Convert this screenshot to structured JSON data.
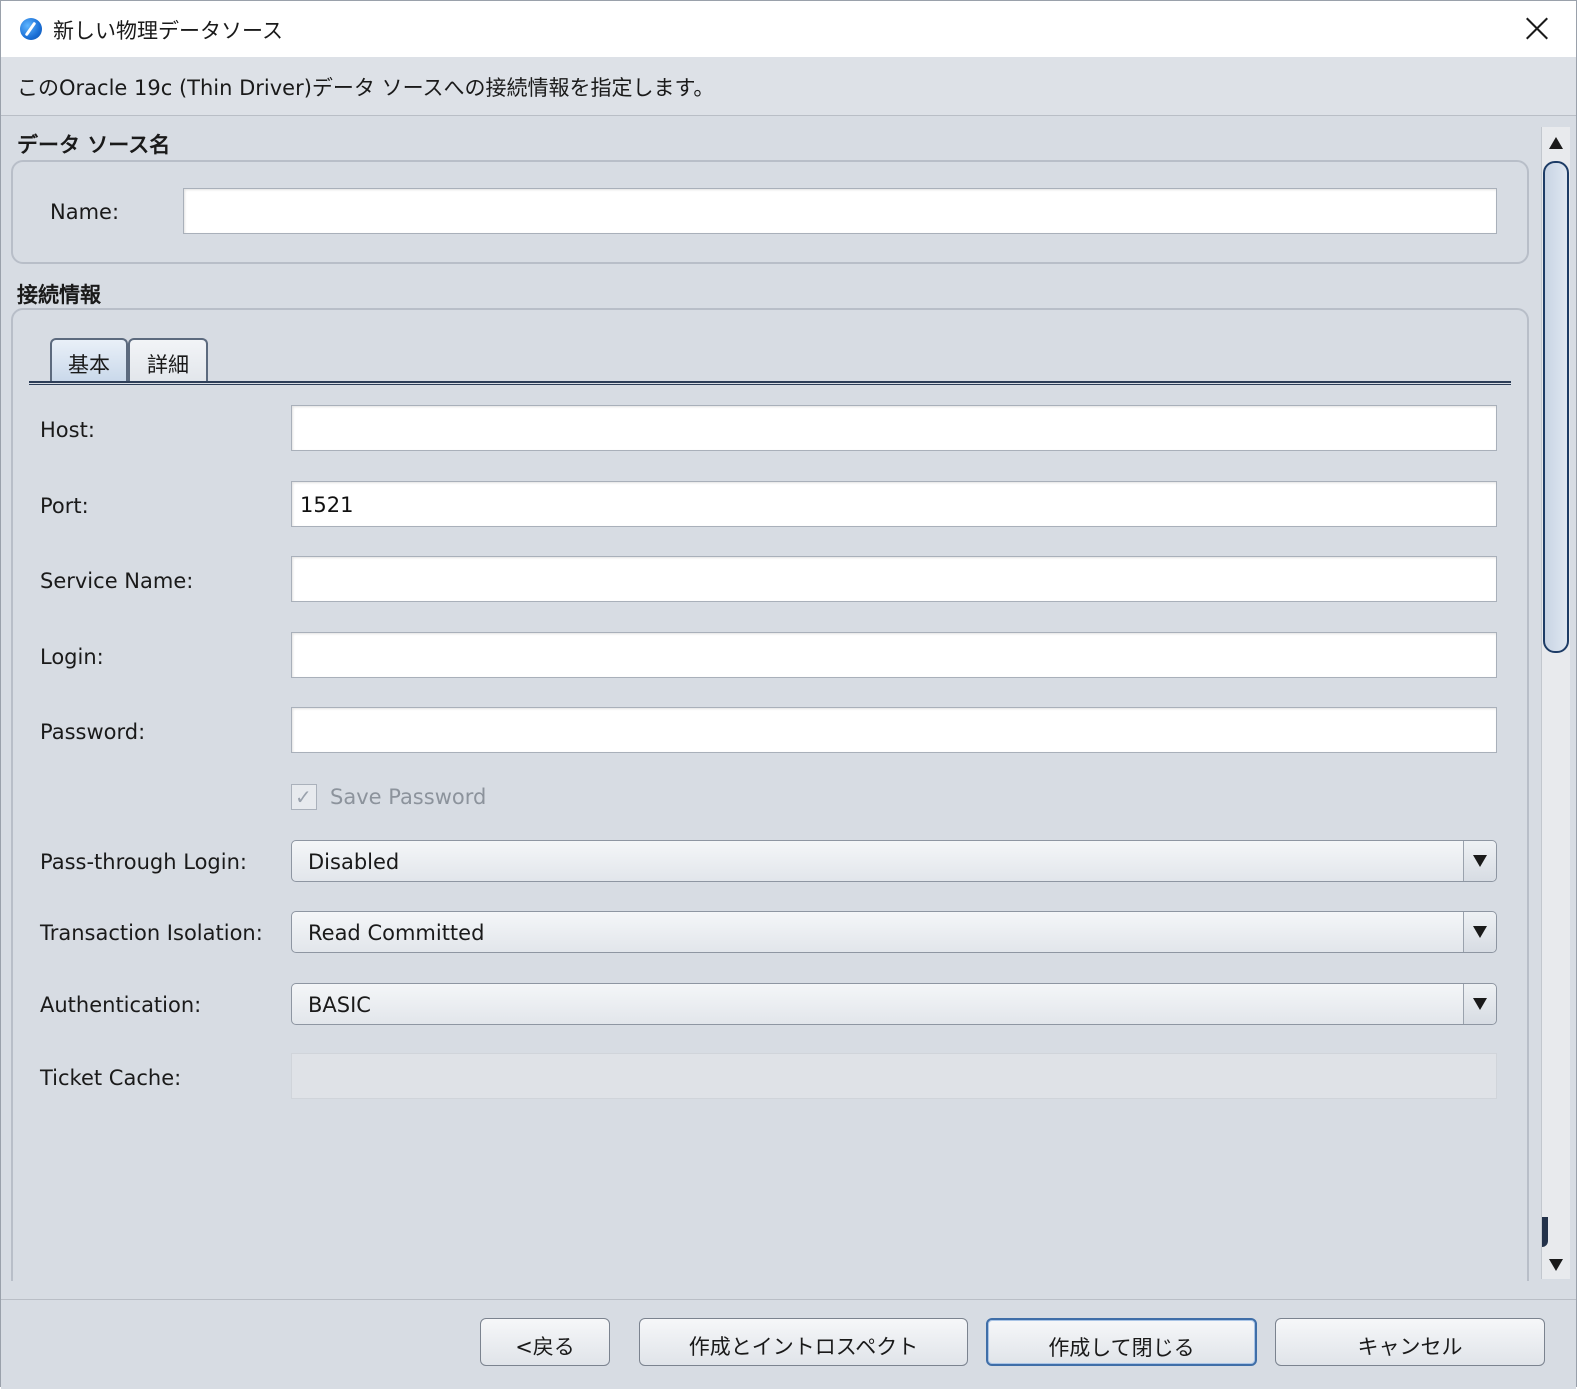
{
  "window": {
    "title": "新しい物理データソース"
  },
  "info": {
    "text": "このOracle 19c (Thin Driver)データ ソースへの接続情報を指定します。"
  },
  "datasource_section": {
    "title": "データ ソース名",
    "name_label": "Name:",
    "name_value": ""
  },
  "connection_section": {
    "title": "接続情報",
    "tabs": [
      {
        "label": "基本",
        "active": true
      },
      {
        "label": "詳細",
        "active": false
      }
    ],
    "fields": {
      "host_label": "Host:",
      "host_value": "",
      "port_label": "Port:",
      "port_value": "1521",
      "service_label": "Service Name:",
      "service_value": "",
      "login_label": "Login:",
      "login_value": "",
      "password_label": "Password:",
      "password_value": "",
      "save_password_label": "Save Password",
      "save_password_checked": true,
      "save_password_enabled": false,
      "passthrough_label": "Pass-through Login:",
      "passthrough_value": "Disabled",
      "isolation_label": "Transaction Isolation:",
      "isolation_value": "Read Committed",
      "auth_label": "Authentication:",
      "auth_value": "BASIC",
      "ticket_label": "Ticket Cache:",
      "ticket_value": ""
    }
  },
  "footer": {
    "back": "<戻る",
    "create_introspect": "作成とイントロスペクト",
    "create_close": "作成して閉じる",
    "cancel": "キャンセル"
  },
  "icons": {
    "app": "app-logo-icon",
    "close": "close-icon",
    "scroll_up": "arrow-up-icon",
    "scroll_down": "arrow-down-icon",
    "dropdown": "chevron-down-icon",
    "checkmark": "checkmark-icon"
  },
  "colors": {
    "window_bg": "#d7dce3",
    "active_tab": "#c9d8ea",
    "default_button_border": "#3f6ea8"
  }
}
